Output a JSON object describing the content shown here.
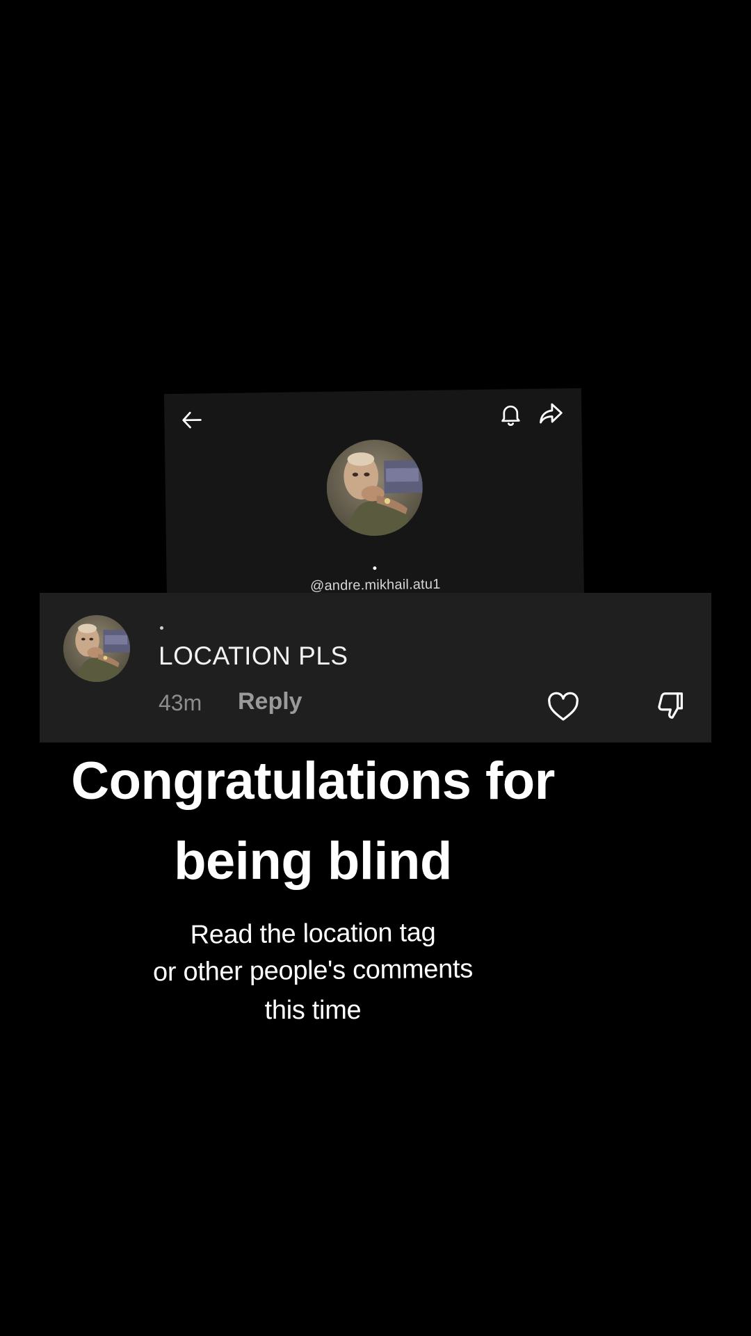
{
  "profile": {
    "handle": "@andre.mikhail.atu1",
    "icons": {
      "back": "arrow-left-icon",
      "notifications": "bell-icon",
      "share": "share-arrow-icon"
    }
  },
  "comment": {
    "text": "LOCATION PLS",
    "time": "43m",
    "reply_label": "Reply",
    "icons": {
      "like": "heart-outline-icon",
      "dislike": "thumbs-down-icon"
    }
  },
  "caption": {
    "headline_line1": "Congratulations for",
    "headline_line2": "being blind",
    "sub_line1": "Read the location tag",
    "sub_line2": "or other people's comments",
    "sub_line3": "this time"
  },
  "colors": {
    "background": "#000000",
    "profile_card": "#161616",
    "comment_card": "#1f1f1f",
    "muted_text": "#8d8d8d"
  }
}
